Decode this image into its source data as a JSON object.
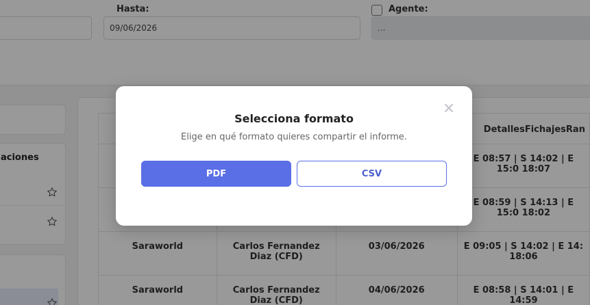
{
  "filters": {
    "hasta_label": "Hasta:",
    "hasta_value": "09/06/2026",
    "agente_label": "Agente:",
    "agente_value": "..."
  },
  "sidebar": {
    "card_title": "aciones"
  },
  "table": {
    "header_detalles": "DetallesFichajesRan",
    "rows": [
      {
        "detalles": "E 08:57 | S 14:02 | E 15:0 18:07"
      },
      {
        "detalles": "E 08:59 | S 14:13 | E 15:0 18:02"
      },
      {
        "empresa": "Saraworld",
        "agente": "Carlos Fernandez Diaz (CFD)",
        "fecha": "03/06/2026",
        "detalles": "E 09:05 | S 14:02 | E 14: 18:06"
      },
      {
        "empresa": "Saraworld",
        "agente": "Carlos Fernandez Diaz (CFD)",
        "fecha": "04/06/2026",
        "detalles": "E 08:58 | S 14:01 | E 14:59"
      }
    ]
  },
  "modal": {
    "title": "Selecciona formato",
    "subtitle": "Elige en qué formato quieres compartir el informe.",
    "pdf_label": "PDF",
    "csv_label": "CSV",
    "close_icon": "close-icon"
  },
  "colors": {
    "accent": "#5a6fe5",
    "overlay": "rgba(0,0,0,0.4)"
  }
}
